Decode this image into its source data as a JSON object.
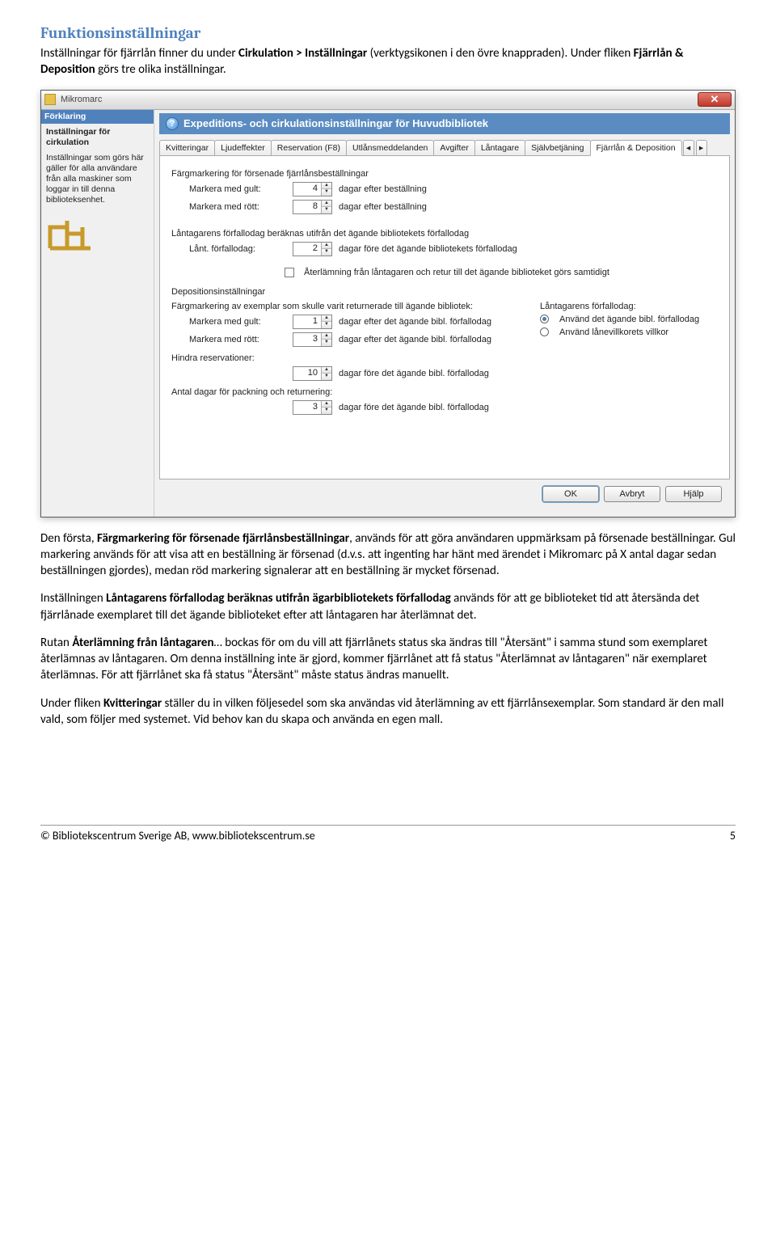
{
  "doc": {
    "section_title": "Funktionsinställningar",
    "intro_1a": "Inställningar för fjärrlån finner du under ",
    "intro_1b": "Cirkulation > Inställningar",
    "intro_1c": " (verktygsikonen i den övre knappraden). Under fliken ",
    "intro_1d": "Fjärrlån & Deposition",
    "intro_1e": " görs tre olika inställningar.",
    "p2a": "Den första, ",
    "p2b": "Färgmarkering för försenade fjärrlånsbeställningar",
    "p2c": ", används för att göra användaren uppmärksam på försenade beställningar. Gul markering används för att visa att en beställning är försenad (d.v.s. att ingenting har hänt med ärendet i Mikromarc på X antal dagar sedan beställningen gjordes), medan röd markering signalerar att en beställning är mycket försenad.",
    "p3a": "Inställningen ",
    "p3b": "Låntagarens förfallodag beräknas utifrån ägarbibliotekets förfallodag",
    "p3c": " används för att ge biblioteket tid att återsända det fjärrlånade exemplaret till det ägande biblioteket efter att låntagaren har återlämnat det.",
    "p4a": "Rutan ",
    "p4b": "Återlämning från låntagaren",
    "p4c": "… bockas för om du vill att fjärrlånets status ska ändras till \"Återsänt\" i samma stund som exemplaret återlämnas av låntagaren. Om denna inställning inte är gjord, kommer fjärrlånet att få status \"Återlämnat av låntagaren\" när exemplaret återlämnas. För att fjärrlånet ska få status \"Återsänt\" måste status ändras manuellt.",
    "p5a": "Under fliken ",
    "p5b": "Kvitteringar",
    "p5c": " ställer du in vilken följesedel som ska användas vid återlämning av ett fjärrlånsexemplar. Som standard är den mall vald, som följer med systemet. Vid behov kan du skapa och använda en egen mall.",
    "footer_text": "© Bibliotekscentrum Sverige AB, www.bibliotekscentrum.se",
    "page_number": "5"
  },
  "win": {
    "title": "Mikromarc",
    "sidebar": {
      "header": "Förklaring",
      "sub": "Inställningar för cirkulation",
      "desc": "Inställningar som görs här gäller för alla användare från alla maskiner som loggar in till denna biblioteksenhet."
    },
    "dlg_title": "Expeditions- och cirkulationsinställningar för Huvudbibliotek",
    "tabs": [
      "Kvitteringar",
      "Ljudeffekter",
      "Reservation (F8)",
      "Utlånsmeddelanden",
      "Avgifter",
      "Låntagare",
      "Självbetjäning",
      "Fjärrlån & Deposition"
    ],
    "sec1": "Färgmarkering för försenade fjärrlånsbeställningar",
    "row_gult": "Markera med gult:",
    "row_rott": "Markera med rött:",
    "after_order": "dagar efter beställning",
    "val_gult": "4",
    "val_rott": "8",
    "sec2": "Låntagarens förfallodag beräknas utifrån det ägande bibliotekets förfallodag",
    "row_lant": "Lånt. förfallodag:",
    "val_lant": "2",
    "after_lant": "dagar före det ägande bibliotekets förfallodag",
    "chk_label": "Återlämning från låntagaren och retur till det ägande biblioteket görs samtidigt",
    "sec3": "Depositionsinställningar",
    "sec3b": "Färgmarkering av exemplar som skulle varit returnerade till ägande bibliotek:",
    "after_dep": "dagar efter det ägande bibl. förfallodag",
    "val_dep_gult": "1",
    "val_dep_rott": "3",
    "hindra": "Hindra reservationer:",
    "val_hindra": "10",
    "before_dep": "dagar före det ägande bibl. förfallodag",
    "pack": "Antal dagar för packning och returnering:",
    "val_pack": "3",
    "rightcol_title": "Låntagarens förfallodag:",
    "radio1": "Använd det ägande bibl. förfallodag",
    "radio2": "Använd lånevillkorets villkor",
    "btn_ok": "OK",
    "btn_cancel": "Avbryt",
    "btn_help": "Hjälp"
  }
}
